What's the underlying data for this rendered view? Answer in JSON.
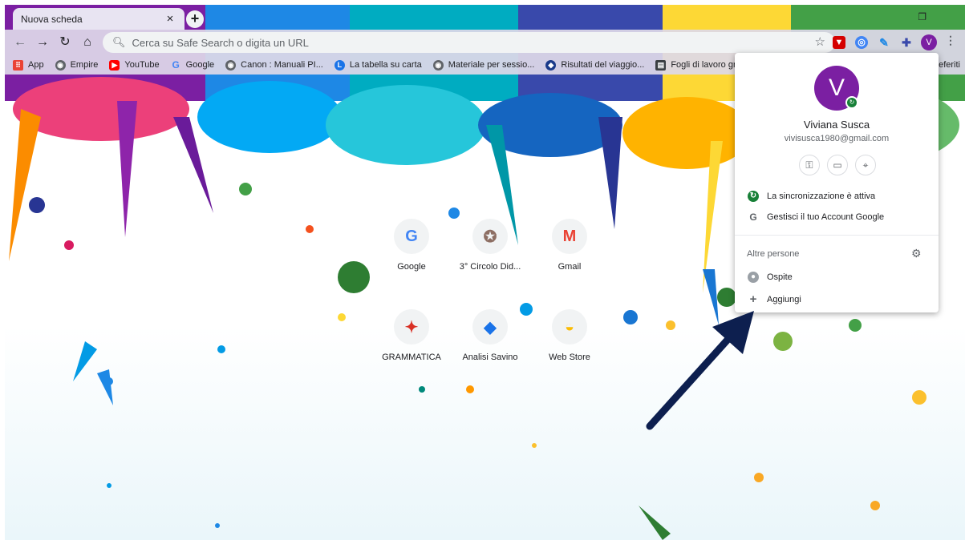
{
  "browser": {
    "tab_title": "Nuova scheda",
    "tab_close": "×",
    "new_tab": "+",
    "omnibox_placeholder": "Cerca su Safe Search o digita un URL",
    "avatar_letter": "V"
  },
  "bookmarks": [
    {
      "label": "App",
      "icon": "apps-grid-icon",
      "color": "#ea4335"
    },
    {
      "label": "Empire",
      "icon": "globe-icon",
      "color": "#5f6368"
    },
    {
      "label": "YouTube",
      "icon": "youtube-icon",
      "color": "#ff0000"
    },
    {
      "label": "Google",
      "icon": "google-icon",
      "color": "#4285f4"
    },
    {
      "label": "Canon : Manuali PI...",
      "icon": "globe-icon",
      "color": "#5f6368"
    },
    {
      "label": "La tabella su carta",
      "icon": "globe-icon",
      "color": "#1a73e8"
    },
    {
      "label": "Materiale per sessio...",
      "icon": "globe-icon",
      "color": "#5f6368"
    },
    {
      "label": "Risultati del viaggio...",
      "icon": "route-icon",
      "color": "#1a3a8a"
    },
    {
      "label": "Fogli di lavoro grat",
      "icon": "sheet-icon",
      "color": "#3c4043"
    }
  ],
  "bookmarks_more": "eferiti",
  "shortcuts": [
    {
      "label": "Google",
      "glyph": "G",
      "color": "#4285f4"
    },
    {
      "label": "3° Circolo Did...",
      "glyph": "✪",
      "color": "#8d6e63"
    },
    {
      "label": "Gmail",
      "glyph": "M",
      "color": "#ea4335"
    },
    {
      "label": "GRAMMATICA",
      "glyph": "✦",
      "color": "#d93025"
    },
    {
      "label": "Analisi Savino",
      "glyph": "◆",
      "color": "#1a73e8"
    },
    {
      "label": "Web Store",
      "glyph": "◒",
      "color": "#fbbc04"
    }
  ],
  "profile": {
    "avatar_letter": "V",
    "name": "Viviana Susca",
    "email": "vivisusca1980@gmail.com",
    "sync_label": "La sincronizzazione è attiva",
    "manage_label": "Gestisci il tuo Account Google",
    "others_heading": "Altre persone",
    "guest_label": "Ospite",
    "add_label": "Aggiungi",
    "accent": "#7b1fa2"
  }
}
